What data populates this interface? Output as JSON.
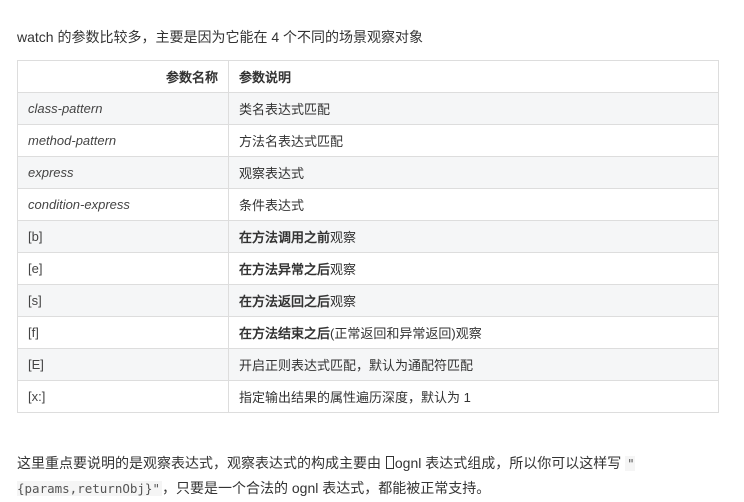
{
  "intro": "watch 的参数比较多，主要是因为它能在 4 个不同的场景观察对象",
  "table": {
    "headers": [
      "参数名称",
      "参数说明"
    ],
    "rows": [
      {
        "name": "class-pattern",
        "italic": true,
        "desc": [
          {
            "t": "类名表达式匹配"
          }
        ]
      },
      {
        "name": "method-pattern",
        "italic": true,
        "desc": [
          {
            "t": "方法名表达式匹配"
          }
        ]
      },
      {
        "name": "express",
        "italic": true,
        "desc": [
          {
            "t": "观察表达式"
          }
        ]
      },
      {
        "name": "condition-express",
        "italic": true,
        "desc": [
          {
            "t": "条件表达式"
          }
        ]
      },
      {
        "name": "[b]",
        "italic": false,
        "desc": [
          {
            "t": "在",
            "b": true
          },
          {
            "t": "方法调用之前",
            "b": true
          },
          {
            "t": "观察"
          }
        ]
      },
      {
        "name": "[e]",
        "italic": false,
        "desc": [
          {
            "t": "在",
            "b": true
          },
          {
            "t": "方法异常之后",
            "b": true
          },
          {
            "t": "观察"
          }
        ]
      },
      {
        "name": "[s]",
        "italic": false,
        "desc": [
          {
            "t": "在",
            "b": true
          },
          {
            "t": "方法返回之后",
            "b": true
          },
          {
            "t": "观察"
          }
        ]
      },
      {
        "name": "[f]",
        "italic": false,
        "desc": [
          {
            "t": "在",
            "b": true
          },
          {
            "t": "方法结束之后",
            "b": true
          },
          {
            "t": "(正常返回和异常返回)观察"
          }
        ]
      },
      {
        "name": "[E]",
        "italic": false,
        "desc": [
          {
            "t": "开启正则表达式匹配，默认为通配符匹配"
          }
        ]
      },
      {
        "name": "[x:]",
        "italic": false,
        "desc": [
          {
            "t": "指定输出结果的属性遍历深度，默认为 1"
          }
        ]
      }
    ]
  },
  "outro": {
    "part1": "这里重点要说明的是观察表达式，观察表达式的构成主要由 ",
    "part2": "ognl 表达式组成，所以你可以这样写 ",
    "code": "\"{params,returnObj}\"",
    "part3": "，只要是一个合法的 ognl 表达式，都能被正常支持。"
  }
}
